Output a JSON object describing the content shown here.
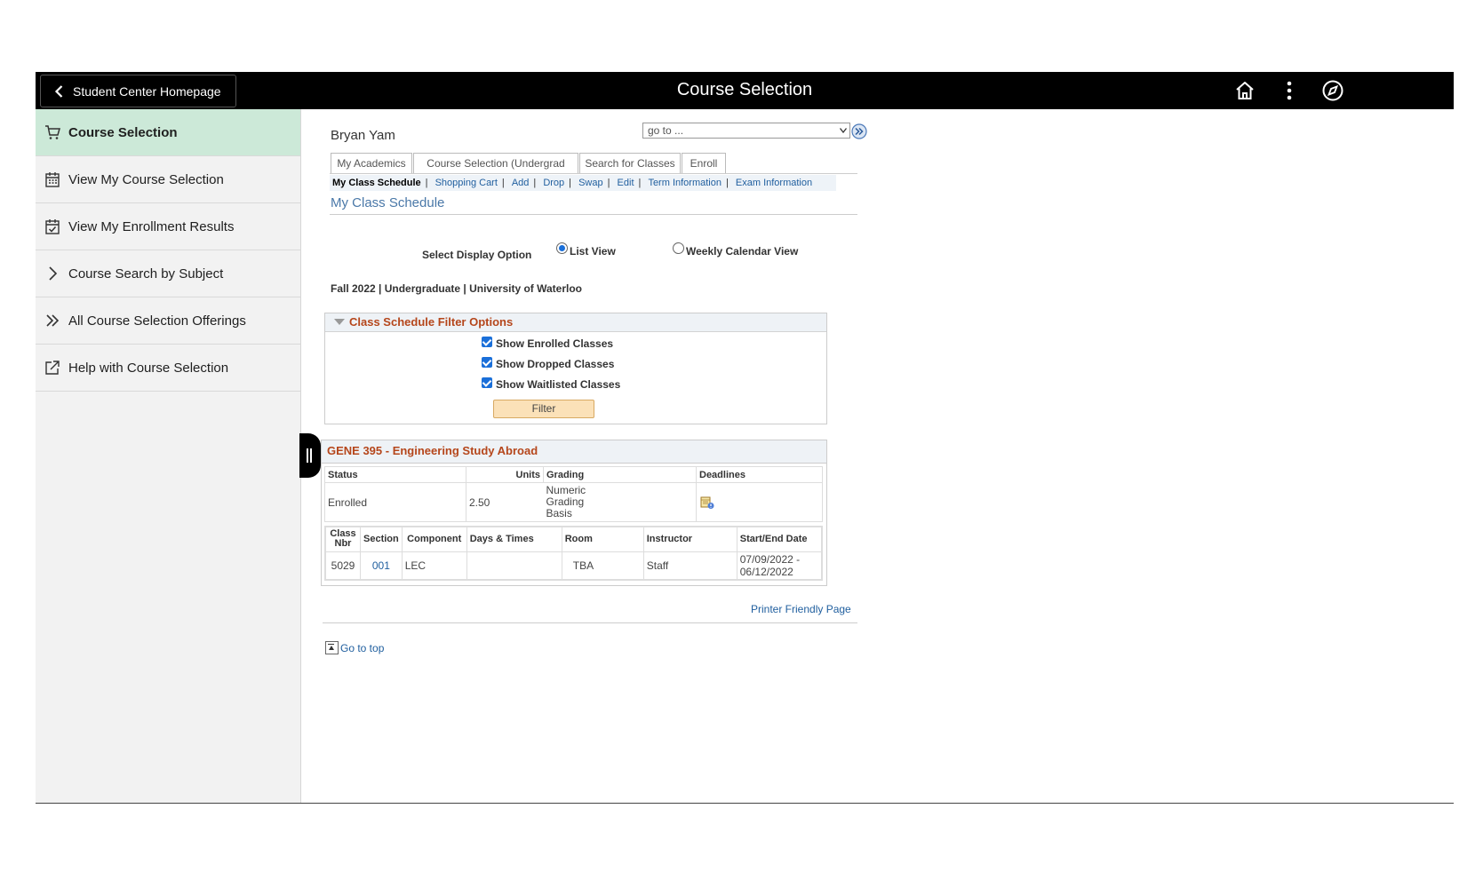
{
  "header": {
    "back_label": "Student Center Homepage",
    "title": "Course Selection",
    "icons": [
      "home-icon",
      "more-vert-icon",
      "compass-icon"
    ]
  },
  "sidebar": {
    "items": [
      {
        "label": "Course Selection",
        "icon": "cart-icon",
        "active": true
      },
      {
        "label": "View My Course Selection",
        "icon": "calendar-icon"
      },
      {
        "label": "View My Enrollment Results",
        "icon": "calendar-check-icon"
      },
      {
        "label": "Course Search by Subject",
        "icon": "chevron-right-icon"
      },
      {
        "label": "All Course Selection Offerings",
        "icon": "double-chevron-right-icon"
      },
      {
        "label": "Help with Course Selection",
        "icon": "external-link-icon"
      }
    ]
  },
  "main": {
    "student_name": "Bryan Yam",
    "goto_select": "go to ...",
    "tabs": [
      "My Academics",
      "Course Selection (Undergrad only)",
      "Search for Classes",
      "Enroll"
    ],
    "subnav": [
      "My Class Schedule",
      "Shopping Cart",
      "Add",
      "Drop",
      "Swap",
      "Edit",
      "Term Information",
      "Exam Information"
    ],
    "page_title": "My Class Schedule",
    "display_option_label": "Select Display Option",
    "display_options": [
      "List View",
      "Weekly Calendar View"
    ],
    "selected_display": "List View",
    "term_line": "Fall 2022 | Undergraduate | University of Waterloo",
    "filter": {
      "title": "Class Schedule Filter Options",
      "options": [
        {
          "label": "Show Enrolled Classes",
          "checked": true
        },
        {
          "label": "Show Dropped Classes",
          "checked": true
        },
        {
          "label": "Show Waitlisted Classes",
          "checked": true
        }
      ],
      "button": "Filter"
    },
    "class": {
      "title": "GENE 395 - Engineering Study Abroad",
      "summary_headers": [
        "Status",
        "Units",
        "Grading",
        "Deadlines"
      ],
      "summary": {
        "status": "Enrolled",
        "units": "2.50",
        "grading": "Numeric Grading Basis",
        "deadlines_icon": "deadlines-calendar-icon"
      },
      "section_headers": [
        "Class Nbr",
        "Section",
        "Component",
        "Days & Times",
        "Room",
        "Instructor",
        "Start/End Date"
      ],
      "sections": [
        {
          "class_nbr": "5029",
          "section": "001",
          "component": "LEC",
          "days_times": "",
          "room": "TBA",
          "instructor": "Staff",
          "dates": "07/09/2022 - 06/12/2022"
        }
      ]
    },
    "printer_friendly": "Printer Friendly Page",
    "go_to_top": "Go to top"
  }
}
